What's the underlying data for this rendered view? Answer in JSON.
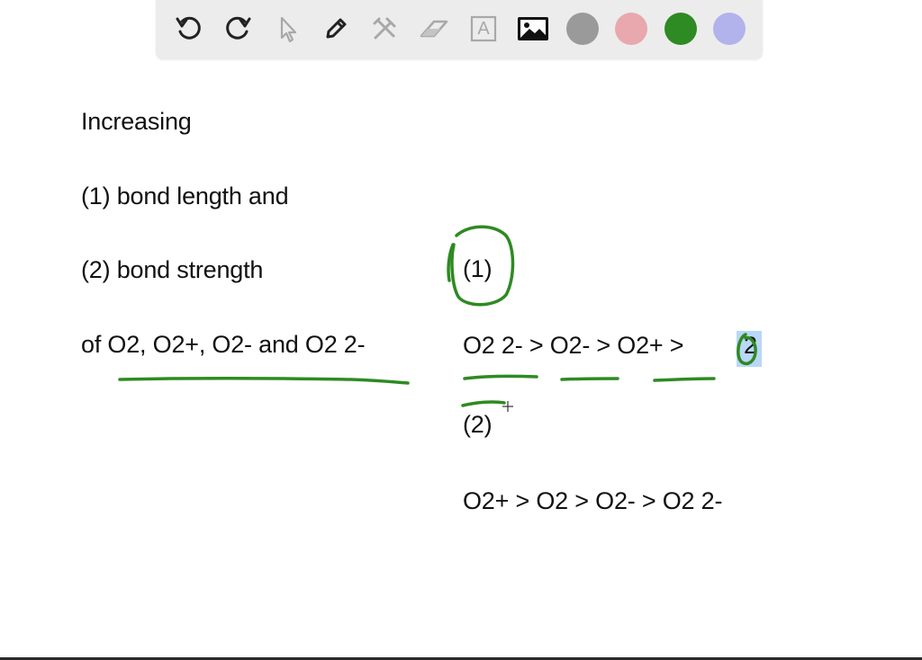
{
  "toolbar": {
    "tools": [
      "undo-icon",
      "redo-icon",
      "pointer-icon",
      "pen-icon",
      "tools-icon",
      "eraser-icon",
      "text-icon",
      "image-icon"
    ],
    "colors": [
      "#9a9a9a",
      "#e8a8ad",
      "#2e8a22",
      "#b2b2ec"
    ],
    "text_tool_label": "A"
  },
  "canvas": {
    "title": "Increasing",
    "item1": "(1) bond length and",
    "item2": "(2) bond strength",
    "species": "of O2, O2+, O2- and O2 2-",
    "answer1_label": "(1)",
    "answer1": "O2 2- > O2- > O2+ >",
    "answer1_tail": "2",
    "answer2_label": "(2)",
    "answer2": "O2+ > O2 > O2- > O2 2-",
    "ink_color": "#2e8a22"
  }
}
